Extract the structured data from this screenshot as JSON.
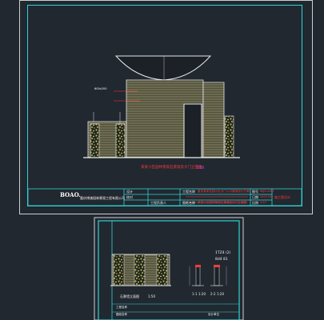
{
  "sheet_top": {
    "logo": "BOAO.",
    "company": "重庆博澳园林景观工程有限公司",
    "callout_label": "600x200",
    "drawing_caption": "某某小区园林景观石景墙及大门立面图",
    "caption_scale": "1:50",
    "title_block": {
      "project_label": "工程名称",
      "project_value": "重庆某某花园小区大门入口景观设计方案",
      "drawing_label": "图纸名称",
      "drawing_value": "某某小区园林景观石景墙及大门立面图",
      "design_label": "设计",
      "check_label": "校对",
      "approve_label": "工程负责人",
      "number_label": "图号",
      "number_value": "WJJG-0001",
      "date_label": "日期",
      "date_value": "2009.04",
      "scale_label": "比例",
      "scale_value": "1:50",
      "stage_value": "施工图设计"
    }
  },
  "sheet_bottom": {
    "elevation_caption": "石景墙立面图",
    "elevation_scale": "1:50",
    "detail_a_caption": "1-1",
    "detail_a_scale": "1:20",
    "detail_b_caption": "2-2",
    "detail_b_scale": "1:20",
    "note_line1": "1TZ4 (2)",
    "note_line2": "8d4 81",
    "title_block": {
      "row1": "工程名称",
      "row2": "图纸名称",
      "row3": "设计单位"
    }
  },
  "colors": {
    "background": "#212830",
    "frame": "#2fd3d3",
    "wall_stripe": "#c9c08a",
    "stone": "#bdb56a",
    "annotation_red": "#ff3a3a"
  }
}
